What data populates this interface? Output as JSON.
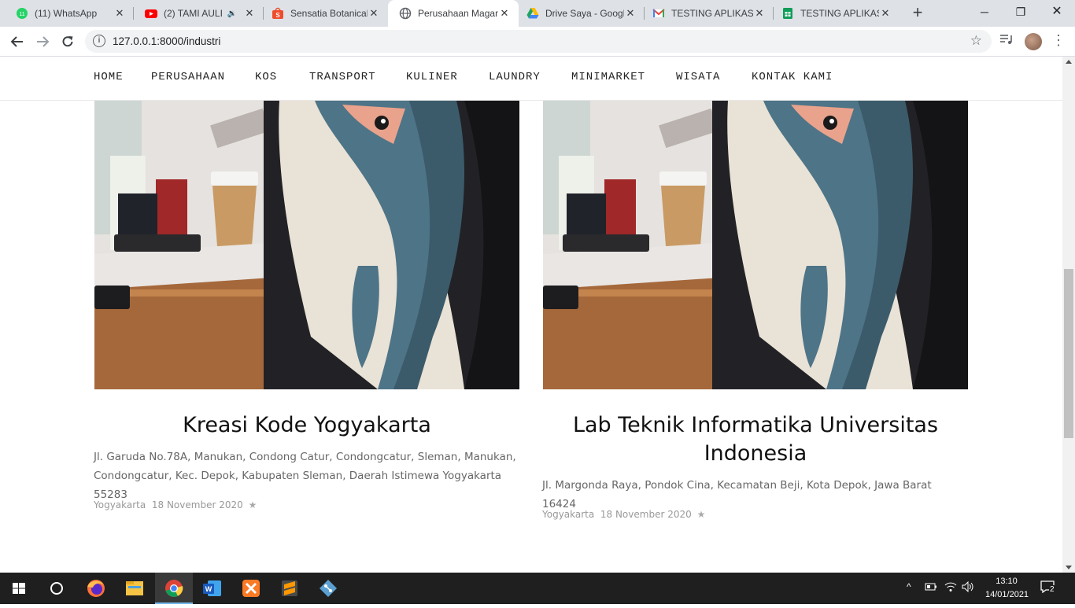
{
  "browser": {
    "tabs": [
      {
        "title": "(11) WhatsApp",
        "icon": "whatsapp-icon",
        "icon_color": "#25d366"
      },
      {
        "title": "(2) TAMI AULI",
        "icon": "youtube-icon",
        "icon_color": "#ff0000",
        "audio": "speaker-icon"
      },
      {
        "title": "Sensatia Botanicals",
        "icon": "shopee-icon",
        "icon_color": "#ee4d2d"
      },
      {
        "title": "Perusahaan Magang",
        "icon": "globe-icon",
        "icon_color": "#5f6368",
        "active": true
      },
      {
        "title": "Drive Saya - Google",
        "icon": "drive-icon",
        "icon_color": "#1fa463"
      },
      {
        "title": "TESTING APLIKASI",
        "icon": "gmail-icon",
        "icon_color": "#ea4335"
      },
      {
        "title": "TESTING APLIKASI",
        "icon": "sheets-icon",
        "icon_color": "#0f9d58"
      }
    ],
    "new_tab_label": "+",
    "url": "127.0.0.1:8000/industri",
    "close_glyph": "✕"
  },
  "site": {
    "nav": [
      "HOME",
      "PERUSAHAAN",
      "KOS",
      "TRANSPORT",
      "KULINER",
      "LAUNDRY",
      "MINIMARKET",
      "WISATA",
      "KONTAK KAMI"
    ],
    "cards": [
      {
        "title": "Kreasi Kode Yogyakarta",
        "address": "Jl. Garuda No.78A, Manukan, Condong Catur, Condongcatur, Sleman, Manukan, Condongcatur, Kec. Depok, Kabupaten Sleman, Daerah Istimewa Yogyakarta 55283",
        "city": "Yogyakarta",
        "date": "18 November 2020",
        "star": "★"
      },
      {
        "title": "Lab Teknik Informatika Universitas Indonesia",
        "address": "Jl. Margonda Raya, Pondok Cina, Kecamatan Beji, Kota Depok, Jawa Barat 16424",
        "city": "Yogyakarta",
        "date": "18 November 2020",
        "star": "★"
      }
    ]
  },
  "taskbar": {
    "apps": [
      "start-icon",
      "search-icon",
      "firefox-icon",
      "file-explorer-icon",
      "chrome-icon",
      "word-icon",
      "xampp-icon",
      "sublime-icon",
      "git-icon"
    ],
    "time": "13:10",
    "date": "14/01/2021",
    "notifications": "2"
  }
}
